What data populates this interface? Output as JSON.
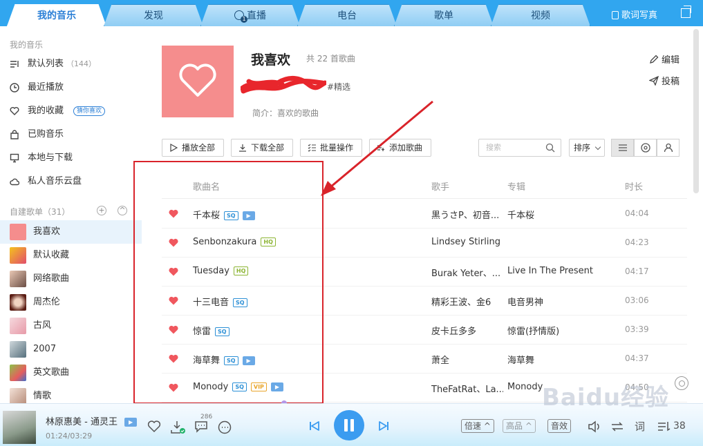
{
  "tabs": [
    {
      "label": "我的音乐",
      "active": true
    },
    {
      "label": "发现",
      "active": false
    },
    {
      "label": "直播",
      "active": false,
      "icon": "live-user-icon"
    },
    {
      "label": "电台",
      "active": false
    },
    {
      "label": "歌单",
      "active": false
    },
    {
      "label": "视频",
      "active": false
    }
  ],
  "top_right": {
    "lyrics_label": "歌词写真"
  },
  "sidebar": {
    "my_music_title": "我的音乐",
    "items": [
      {
        "label": "默认列表",
        "count": "（144）",
        "icon": "list-icon"
      },
      {
        "label": "最近播放",
        "icon": "clock-icon"
      },
      {
        "label": "我的收藏",
        "badge": "猜你喜欢",
        "icon": "heart-outline-icon"
      },
      {
        "label": "已购音乐",
        "icon": "bag-icon"
      },
      {
        "label": "本地与下载",
        "icon": "monitor-icon"
      },
      {
        "label": "私人音乐云盘",
        "icon": "cloud-icon"
      }
    ],
    "playlists_title": "自建歌单（31）",
    "playlists": [
      {
        "label": "我喜欢",
        "active": true
      },
      {
        "label": "默认收藏"
      },
      {
        "label": "网络歌曲"
      },
      {
        "label": "周杰伦"
      },
      {
        "label": "古风"
      },
      {
        "label": "2007"
      },
      {
        "label": "英文歌曲"
      },
      {
        "label": "情歌"
      }
    ]
  },
  "playlist": {
    "title": "我喜欢",
    "count": "共 22 首歌曲",
    "tag": "#精选",
    "desc": "简介：喜欢的歌曲",
    "edit_label": "编辑",
    "submit_label": "投稿"
  },
  "toolbar": {
    "play_all": "播放全部",
    "download_all": "下载全部",
    "batch": "批量操作",
    "add_song": "添加歌曲",
    "search_placeholder": "搜索",
    "sort": "排序"
  },
  "table": {
    "columns": [
      "歌曲名",
      "歌手",
      "专辑",
      "时长"
    ],
    "rows": [
      {
        "name": "千本桜",
        "tags": [
          "SQ",
          "MV"
        ],
        "artist": "黒うさP、初音...",
        "album": "千本桜",
        "duration": "04:04"
      },
      {
        "name": "Senbonzakura",
        "tags": [
          "HQ"
        ],
        "artist": "Lindsey Stirling",
        "album": "",
        "duration": "04:23"
      },
      {
        "name": "Tuesday",
        "tags": [
          "HQ"
        ],
        "artist": "Burak Yeter、...",
        "album": "Live In The Present",
        "duration": "04:17"
      },
      {
        "name": "十三电音",
        "tags": [
          "SQ"
        ],
        "artist": "精彩王波、金6",
        "album": "电音男神",
        "duration": "03:06"
      },
      {
        "name": "惊雷",
        "tags": [
          "SQ"
        ],
        "artist": "皮卡丘多多",
        "album": "惊雷(抒情版)",
        "duration": "03:39"
      },
      {
        "name": "海草舞",
        "tags": [
          "SQ",
          "MV"
        ],
        "artist": "萧全",
        "album": "海草舞",
        "duration": "04:37"
      },
      {
        "name": "Monody",
        "tags": [
          "SQ",
          "VIP",
          "MV"
        ],
        "artist": "TheFatRat、La...",
        "album": "Monody",
        "duration": "04:50"
      }
    ]
  },
  "player": {
    "title": "林原惠美 - 通灵王",
    "time": "01:24/03:29",
    "comment_count": "286",
    "speed": "倍速",
    "quality": "高品",
    "effect": "音效",
    "lyrics": "词",
    "queue_count": "38"
  },
  "watermark": "Baidu经验",
  "colors": {
    "accent": "#31a6ef",
    "heart": "#f0575e",
    "annotation": "#d9232a"
  }
}
